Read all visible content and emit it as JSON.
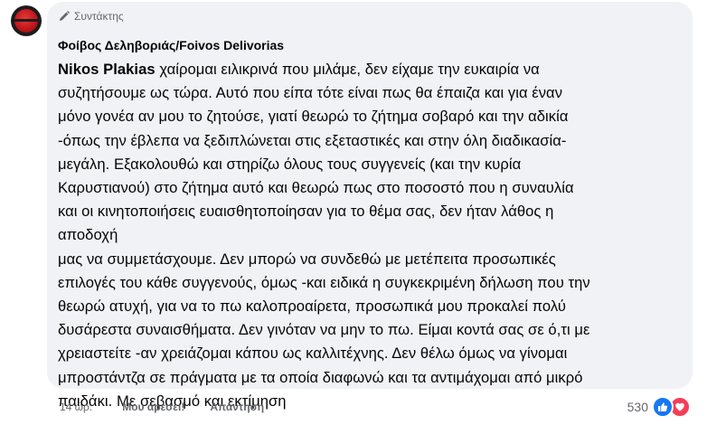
{
  "comment": {
    "badge_label": "Συντάκτης",
    "author_name": "Φοίβος Δεληβοριάς/Foivos Delivorias",
    "mention": "Nikos Plakias",
    "body": " χαίρομαι ειλικρινά που μιλάμε, δεν είχαμε την ευκαιρία να\nσυζητήσουμε ως τώρα. Αυτό που είπα τότε είναι πως θα έπαιζα και για έναν\nμόνο γονέα αν μου το ζητούσε, γιατί θεωρώ το ζήτημα σοβαρό και την αδικία\n-όπως την έβλεπα να ξεδιπλώνεται στις εξεταστικές και στην όλη διαδικασία-\nμεγάλη. Εξακολουθώ και στηρίζω όλους τους συγγενείς (και την κυρία\nΚαρυστιανού) στο ζήτημα αυτό και θεωρώ πως στο ποσοστό που η συναυλία\nκαι οι κινητοποιήσεις ευαισθητοποίησαν για το θέμα σας, δεν ήταν λάθος η\nαποδοχή\nμας να συμμετάσχουμε. Δεν μπορώ να συνδεθώ με μετέπειτα προσωπικές\nεπιλογές του κάθε συγγενούς, όμως -και ειδικά η συγκεκριμένη δήλωση που την\nθεωρώ ατυχή, για να το πω καλοπροαίρετα, προσωπικά μου προκαλεί πολύ\nδυσάρεστα συναισθήματα. Δεν γινόταν να μην το πω. Είμαι κοντά σας σε ό,τι με\nχρειαστείτε -αν χρειάζομαι κάπου ως καλλιτέχνης. Δεν θέλω όμως να γίνομαι\nμπροστάντζα σε πράγματα με τα οποία διαφωνώ και τα αντιμάχομαι από μικρό\nπαιδάκι. Με σεβασμό και εκτίμηση"
  },
  "actions": {
    "time": "14 ώρ.",
    "like_label": "Μου αρέσει!",
    "reply_label": "Απάντηση"
  },
  "reactions": {
    "count": "530",
    "types": [
      "like-icon",
      "heart-icon"
    ]
  },
  "colors": {
    "bubble": "#f0f2f5",
    "like": "#1877f2",
    "heart": "#f33e58",
    "secondary_text": "#65676b"
  }
}
